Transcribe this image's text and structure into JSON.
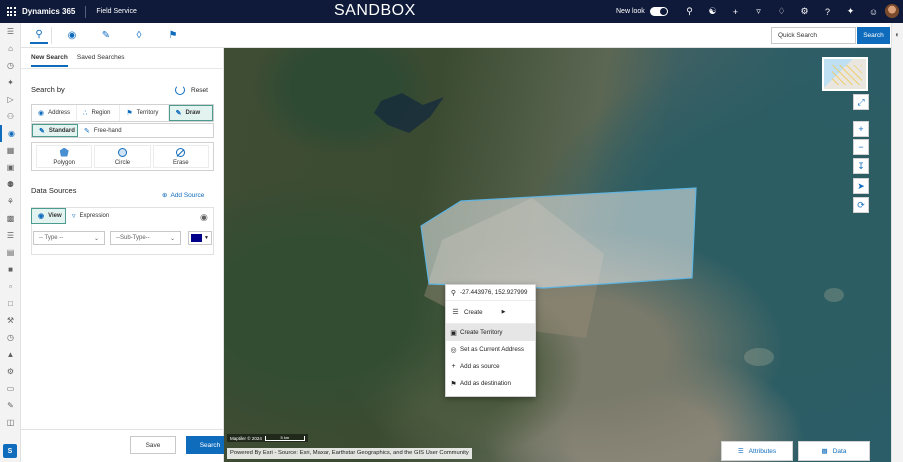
{
  "topbar": {
    "app_title": "Dynamics 365",
    "app_name": "Field Service",
    "environment_label": "SANDBOX",
    "new_look_label": "New look",
    "new_look_on": true,
    "icons": [
      "search-icon",
      "lightbulb-icon",
      "plus-icon",
      "filter-icon",
      "bell-icon",
      "gear-icon",
      "help-icon",
      "copilot-icon",
      "smiley-icon"
    ]
  },
  "rail": {
    "icons": [
      "hamburger-icon",
      "home-icon",
      "clock-icon",
      "pin-icon",
      "play-icon",
      "people-icon",
      "eye-icon",
      "book-icon",
      "calendar-icon",
      "person-add-icon",
      "people-group-icon",
      "id-card-icon",
      "list-icon",
      "clipboard-icon",
      "box-icon",
      "stack-icon",
      "document-icon",
      "wrench-icon",
      "time-icon",
      "cube-icon",
      "settings-icon",
      "inbox-icon",
      "tool-icon",
      "database-icon"
    ],
    "active_index": 6,
    "area_badge": "S"
  },
  "toolbar": {
    "tools": [
      "search-tool",
      "route-tool",
      "measure-tool",
      "layers-tool",
      "flag-tool"
    ],
    "quick_search_placeholder": "Quick Search",
    "search_label": "Search"
  },
  "panel": {
    "tabs": [
      {
        "label": "New Search",
        "active": true
      },
      {
        "label": "Saved Searches",
        "active": false
      }
    ],
    "search_by_title": "Search by",
    "reset_label": "Reset",
    "search_by_options": [
      {
        "label": "Address",
        "icon": "pin-icon",
        "active": false
      },
      {
        "label": "Region",
        "icon": "region-icon",
        "active": false
      },
      {
        "label": "Territory",
        "icon": "flag-icon",
        "active": false
      },
      {
        "label": "Draw",
        "icon": "pencil-icon",
        "active": true
      }
    ],
    "draw_modes": [
      {
        "label": "Standard",
        "icon": "pencil-icon",
        "active": true
      },
      {
        "label": "Free-hand",
        "icon": "pencil-icon",
        "active": false
      }
    ],
    "shapes": [
      {
        "label": "Polygon",
        "icon": "polygon-icon"
      },
      {
        "label": "Circle",
        "icon": "circle-icon"
      },
      {
        "label": "Erase",
        "icon": "erase-icon"
      }
    ],
    "data_sources_title": "Data Sources",
    "add_source_label": "Add Source",
    "ds_modes": [
      {
        "label": "View",
        "icon": "eye-icon",
        "active": true
      },
      {
        "label": "Expression",
        "icon": "filter-icon",
        "active": false
      }
    ],
    "type_placeholder": "-- Type --",
    "subtype_placeholder": "--Sub-Type--",
    "color_value": "#00008b",
    "save_label": "Save",
    "search_label": "Search"
  },
  "map": {
    "context_menu": {
      "coordinates": "-27.443976, 152.927999",
      "create_label": "Create",
      "items": [
        {
          "label": "Create Territory",
          "icon": "territory-icon",
          "highlighted": true
        },
        {
          "label": "Set as Current Address",
          "icon": "target-icon",
          "highlighted": false
        },
        {
          "label": "Add as source",
          "icon": "plus-icon",
          "highlighted": false
        },
        {
          "label": "Add as destination",
          "icon": "flag-icon",
          "highlighted": false
        }
      ]
    },
    "controls": [
      "expand-icon",
      "zoom-in-icon",
      "zoom-out-icon",
      "download-icon",
      "locate-icon",
      "refresh-icon"
    ],
    "scale_provider": "Maptiler © 2024",
    "scale_label": "5 km",
    "attribution": "Powered By Esri - Source: Esri, Maxar, Earthstar Geographics, and the GIS User Community",
    "attributes_label": "Attributes",
    "data_label": "Data"
  }
}
